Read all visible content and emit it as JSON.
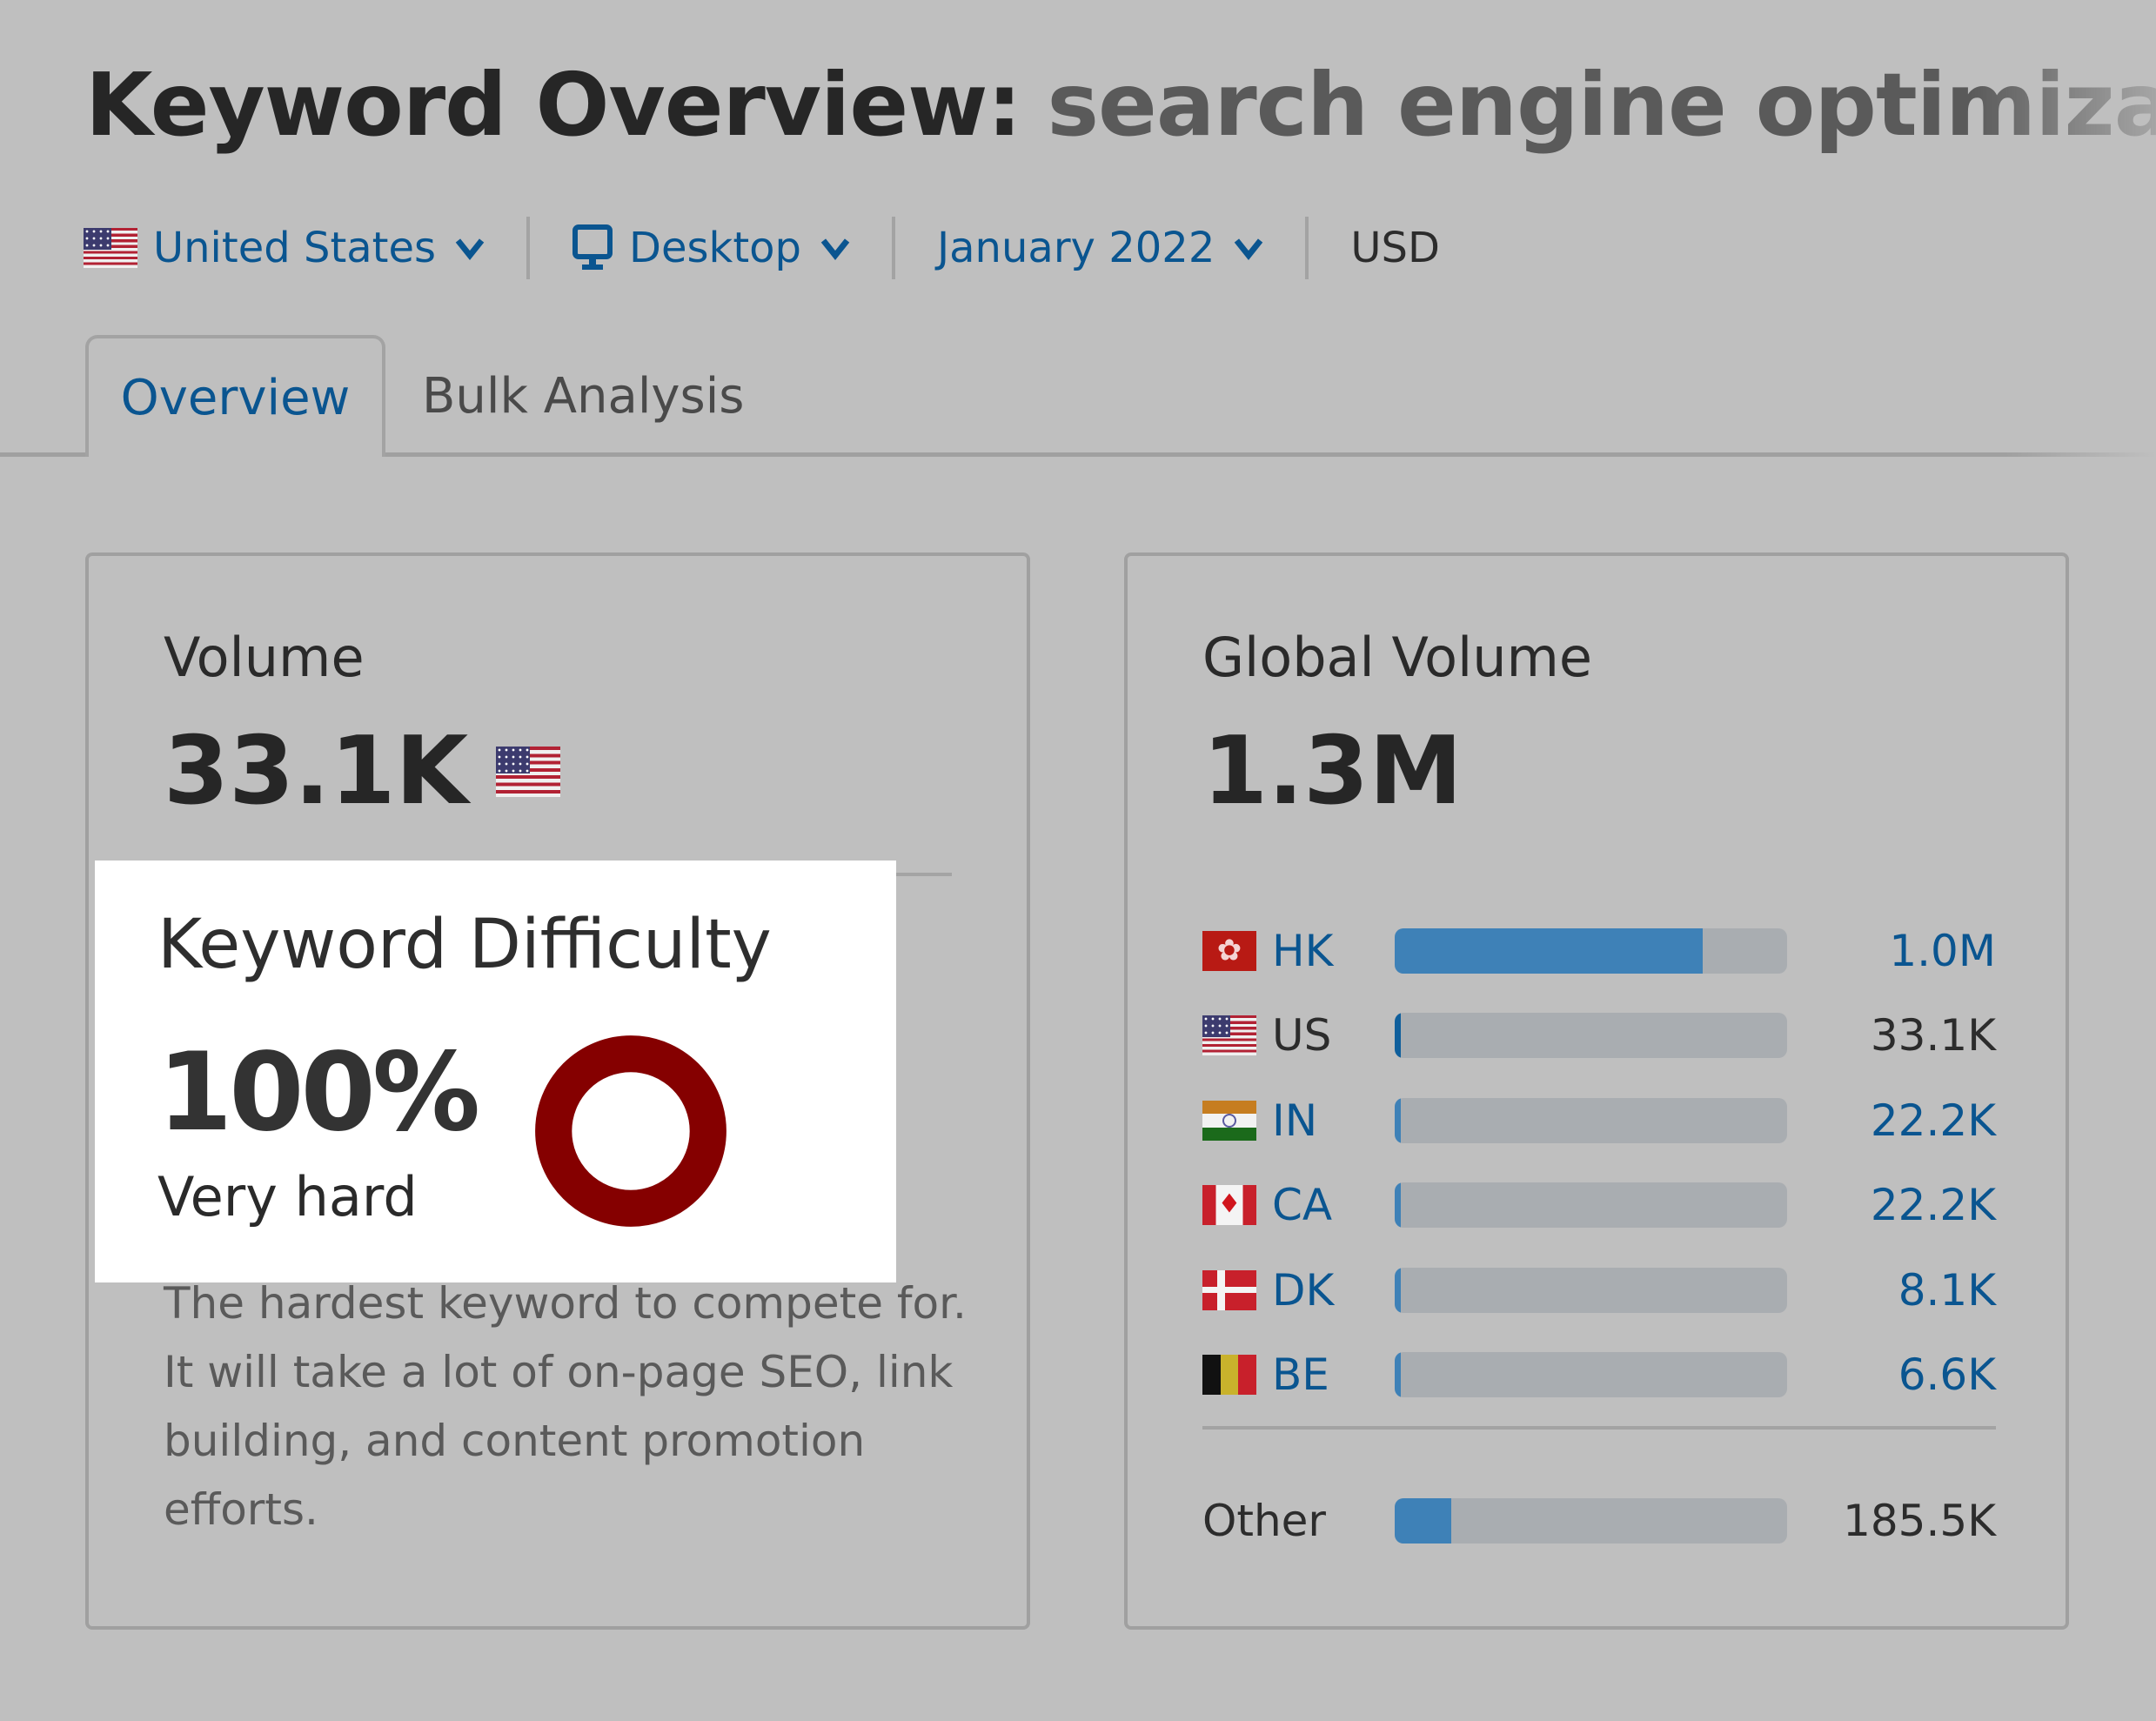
{
  "header": {
    "title_prefix": "Keyword Overview:",
    "keyword": "search engine optimization"
  },
  "filters": {
    "country": {
      "label": "United States",
      "flag": "us",
      "icon": "chevron-down-icon"
    },
    "device": {
      "label": "Desktop",
      "icon": "desktop-icon"
    },
    "date": {
      "label": "January 2022",
      "icon": "chevron-down-icon"
    },
    "currency": "USD"
  },
  "tabs": [
    {
      "label": "Overview",
      "active": true
    },
    {
      "label": "Bulk Analysis",
      "active": false
    }
  ],
  "volume_card": {
    "title": "Volume",
    "value": "33.1K",
    "flag": "us"
  },
  "keyword_difficulty": {
    "title": "Keyword Difficulty",
    "value": "100%",
    "percent": 100,
    "level": "Very hard",
    "ring_color": "#850000",
    "description": "The hardest keyword to compete for. It will take a lot of on-page SEO, link building, and content promotion efforts."
  },
  "global_volume_card": {
    "title": "Global Volume",
    "value": "1.3M",
    "countries": [
      {
        "code": "HK",
        "value": "1.0M",
        "fill_fraction": 0.785,
        "link": true
      },
      {
        "code": "US",
        "value": "33.1K",
        "fill_fraction": 0.015,
        "link": false
      },
      {
        "code": "IN",
        "value": "22.2K",
        "fill_fraction": 0.015,
        "link": true
      },
      {
        "code": "CA",
        "value": "22.2K",
        "fill_fraction": 0.015,
        "link": true
      },
      {
        "code": "DK",
        "value": "8.1K",
        "fill_fraction": 0.015,
        "link": true
      },
      {
        "code": "BE",
        "value": "6.6K",
        "fill_fraction": 0.015,
        "link": true
      }
    ],
    "other": {
      "label": "Other",
      "value": "185.5K",
      "fill_fraction": 0.145
    }
  },
  "colors": {
    "link": "#0a5590",
    "bar_fill": "#3e81b7",
    "bar_fill_current": "#0f5f9c",
    "bar_track": "#a9adb1",
    "difficulty_ring": "#850000"
  }
}
